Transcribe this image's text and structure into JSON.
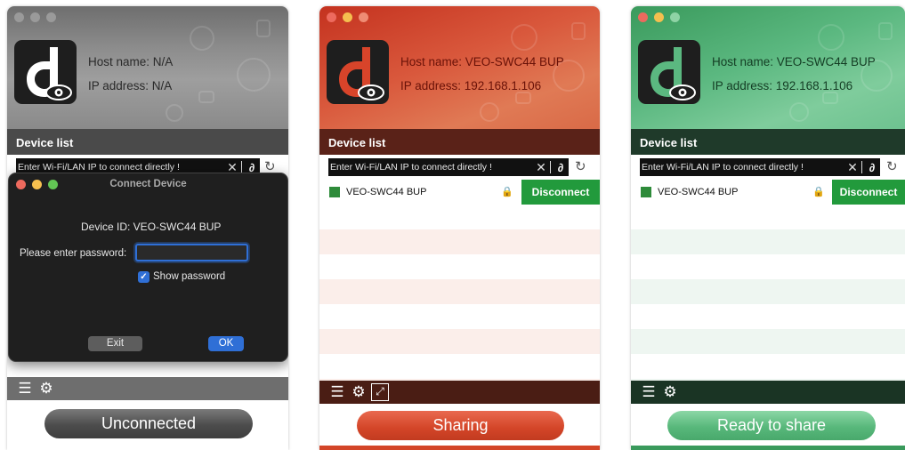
{
  "windows": [
    {
      "id": "unconnected",
      "host_label": "Host name:  N/A",
      "ip_label": "IP address:  N/A",
      "device_list_title": "Device list",
      "ip_placeholder": "Enter Wi-Fi/LAN IP to connect directly !",
      "status_button": "Unconnected",
      "tabs": [
        "list-icon",
        "gear-icon"
      ]
    },
    {
      "id": "sharing",
      "host_label": "Host name:  VEO-SWC44 BUP",
      "ip_label": "IP address:  192.168.1.106",
      "device_list_title": "Device list",
      "ip_placeholder": "Enter Wi-Fi/LAN IP to connect directly !",
      "device": {
        "name": "VEO-SWC44 BUP",
        "action": "Disconnect"
      },
      "status_button": "Sharing",
      "tabs": [
        "list-icon",
        "gear-icon",
        "expand-icon"
      ]
    },
    {
      "id": "ready",
      "host_label": "Host name:  VEO-SWC44 BUP",
      "ip_label": "IP address:  192.168.1.106",
      "device_list_title": "Device list",
      "ip_placeholder": "Enter Wi-Fi/LAN IP to connect directly !",
      "device": {
        "name": "VEO-SWC44 BUP",
        "action": "Disconnect"
      },
      "status_button": "Ready to share",
      "tabs": [
        "list-icon",
        "gear-icon"
      ]
    }
  ],
  "dialog": {
    "title": "Connect Device",
    "device_id": "Device ID:  VEO-SWC44 BUP",
    "password_label": "Please enter password:",
    "password_value": "",
    "show_password_label": "Show password",
    "show_password_checked": true,
    "exit_label": "Exit",
    "ok_label": "OK"
  },
  "colors": {
    "traffic_red": "#ed6a5e",
    "traffic_yellow": "#f5bf4f",
    "traffic_green": "#62c554",
    "disconnect_green": "#229a3c",
    "accent_blue": "#2f6fd6"
  }
}
